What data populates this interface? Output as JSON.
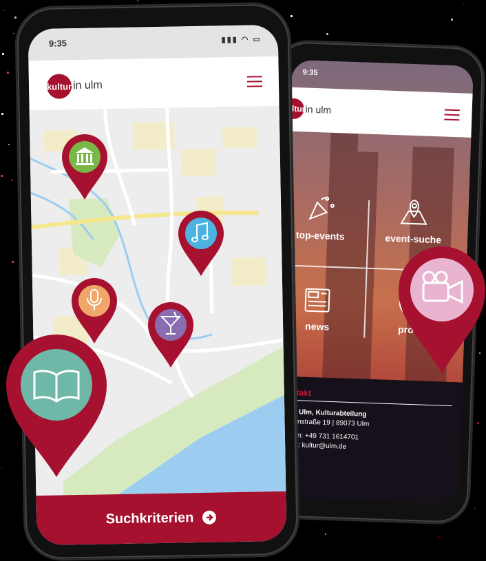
{
  "front_phone": {
    "status_time": "9:35",
    "logo_circle_text": "kultur",
    "logo_rest_text": "in ulm",
    "search_button_label": "Suchkriterien",
    "pins": [
      {
        "icon": "museum-icon",
        "color": "#7ab648"
      },
      {
        "icon": "music-note-icon",
        "color": "#4cb3e0"
      },
      {
        "icon": "microphone-icon",
        "color": "#f0a76a"
      },
      {
        "icon": "cocktail-icon",
        "color": "#8a6db0"
      },
      {
        "icon": "book-icon",
        "color": "#6fb8a8"
      }
    ]
  },
  "back_phone": {
    "status_time": "9:35",
    "logo_circle_text": "kultur",
    "logo_rest_text": "in ulm",
    "tiles": [
      {
        "label": "top-events",
        "icon": "confetti-icon"
      },
      {
        "label": "event-suche",
        "icon": "map-pin-icon"
      },
      {
        "label": "news",
        "icon": "newspaper-icon"
      },
      {
        "label": "profil",
        "icon": "profile-icon"
      }
    ],
    "contact_heading": "Kontakt",
    "contact_lines": [
      "Stadt Ulm, Kulturabteilung",
      "Frauenstraße 19 | 89073 Ulm",
      "Telefon: +49 731 1614701",
      "E-Mail: kultur@ulm.de"
    ]
  },
  "floating_pin": {
    "icon": "video-camera-icon",
    "color": "#e8b4d0"
  },
  "colors": {
    "brand": "#a6112f",
    "map_road": "#ffffff",
    "river": "#8cc8ee",
    "park": "#d4e8b8"
  }
}
